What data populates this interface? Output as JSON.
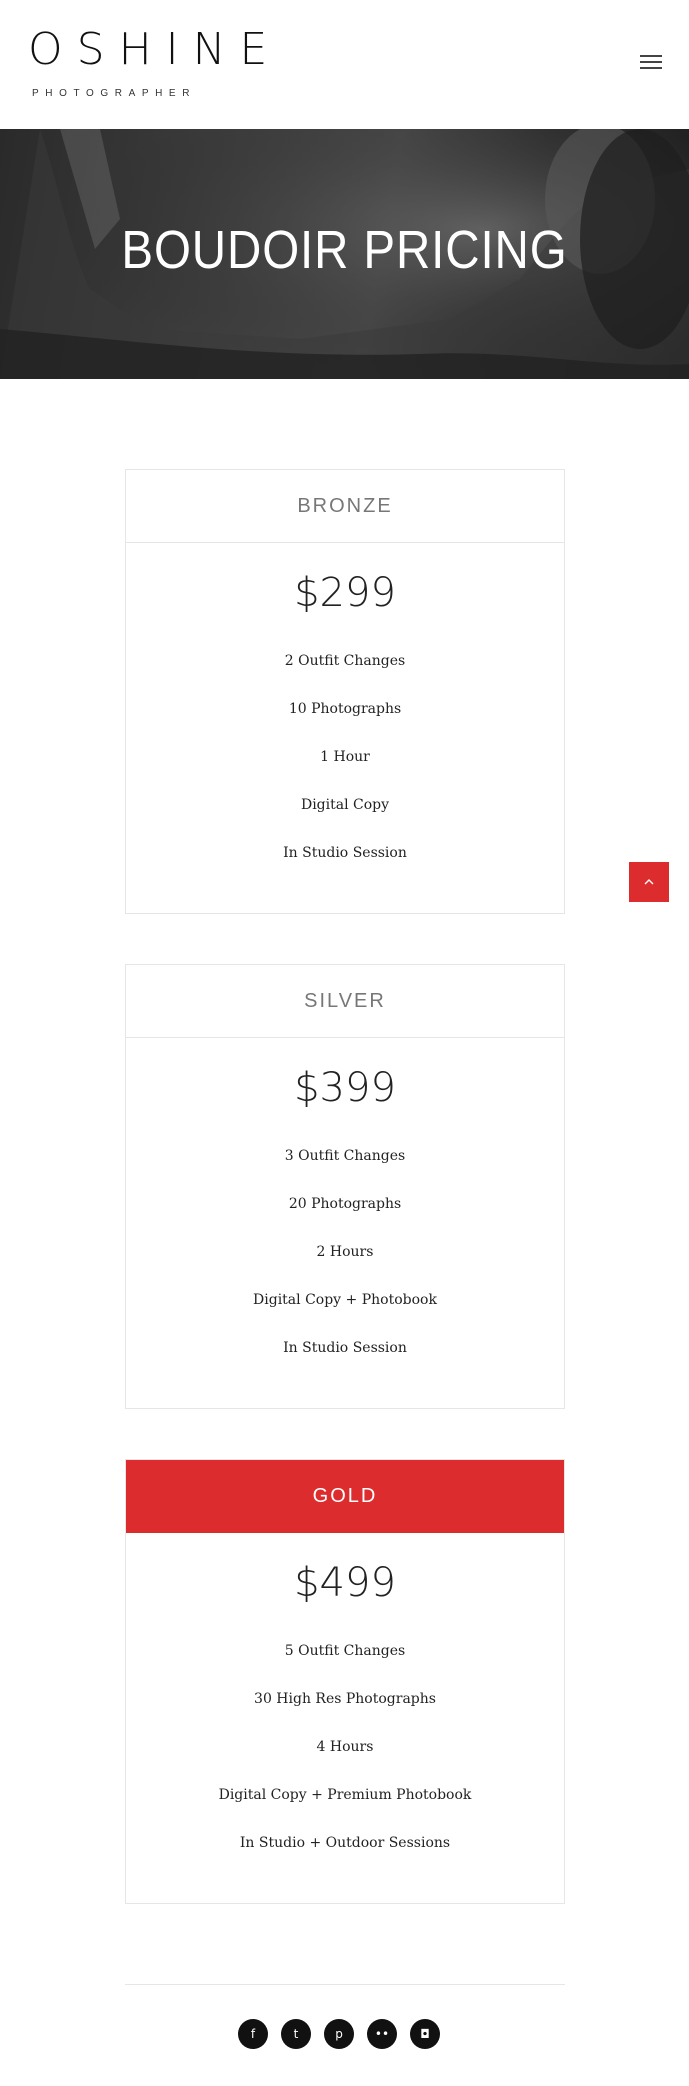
{
  "header": {
    "logo_main": "OSHINE",
    "logo_sub": "PHOTOGRAPHER",
    "menu_icon": "hamburger-icon"
  },
  "hero": {
    "title": "BOUDOIR PRICING"
  },
  "plans": [
    {
      "name": "BRONZE",
      "price": "$299",
      "features": [
        "2 Outfit Changes",
        "10 Photographs",
        "1 Hour",
        "Digital Copy",
        "In Studio Session"
      ]
    },
    {
      "name": "SILVER",
      "price": "$399",
      "features": [
        "3 Outfit Changes",
        "20 Photographs",
        "2 Hours",
        "Digital Copy + Photobook",
        "In Studio Session"
      ]
    },
    {
      "name": "GOLD",
      "price": "$499",
      "features": [
        "5 Outfit Changes",
        "30 High Res Photographs",
        "4 Hours",
        "Digital Copy + Premium Photobook",
        "In Studio + Outdoor Sessions"
      ]
    }
  ],
  "social": [
    {
      "icon": "facebook-icon",
      "glyph": "f"
    },
    {
      "icon": "twitter-icon",
      "glyph": "t"
    },
    {
      "icon": "pinterest-icon",
      "glyph": "p"
    },
    {
      "icon": "flickr-icon",
      "glyph": "••"
    },
    {
      "icon": "instagram-icon",
      "glyph": "◘"
    }
  ],
  "colors": {
    "accent": "#dc2c2e",
    "text": "#222222",
    "border": "#e6e6e6"
  }
}
